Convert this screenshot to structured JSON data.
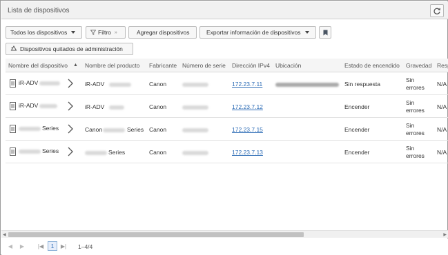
{
  "window": {
    "title": "Lista de dispositivos"
  },
  "toolbar": {
    "all_devices": "Todos los dispositivos",
    "filter": "Filtro",
    "add_devices": "Agregar dispositivos",
    "export": "Exportar información de dispositivos",
    "removed_devices": "Dispositivos quitados de administración"
  },
  "table": {
    "columns": [
      "Nombre del dispositivo",
      "Nombre del producto",
      "Fabricante",
      "Número de serie",
      "Dirección IPv4",
      "Ubicación",
      "Estado de encendido",
      "Gravedad",
      "Resp"
    ],
    "rows": [
      {
        "name": "iR-ADV",
        "product": "iR-ADV",
        "maker": "Canon",
        "ip": "172.23.7.11",
        "power": "Sin respuesta",
        "severity_1": "Sin",
        "severity_2": "errores",
        "resp": "N/A"
      },
      {
        "name": "iR-ADV",
        "product": "iR-ADV",
        "maker": "Canon",
        "ip": "172.23.7.12",
        "power": "Encender",
        "severity_1": "Sin",
        "severity_2": "errores",
        "resp": "N/A"
      },
      {
        "name": "Series",
        "product_prefix": "Canon",
        "product": "Series",
        "maker": "Canon",
        "ip": "172.23.7.15",
        "power": "Encender",
        "severity_1": "Sin",
        "severity_2": "errores",
        "resp": "N/A"
      },
      {
        "name": "Series",
        "product": "Series",
        "maker": "Canon",
        "ip": "172.23.7.13",
        "power": "Encender",
        "severity_1": "Sin",
        "severity_2": "errores",
        "resp": "N/A"
      }
    ]
  },
  "pager": {
    "page": "1",
    "count": "1–4/4"
  },
  "icons": {
    "refresh": "refresh-icon",
    "bookmark": "bookmark-icon",
    "recycle": "recycle-icon",
    "filter": "filter-icon",
    "document": "document-icon"
  },
  "colors": {
    "link": "#2b6bb5",
    "header_bg": "#f1f1f1"
  }
}
